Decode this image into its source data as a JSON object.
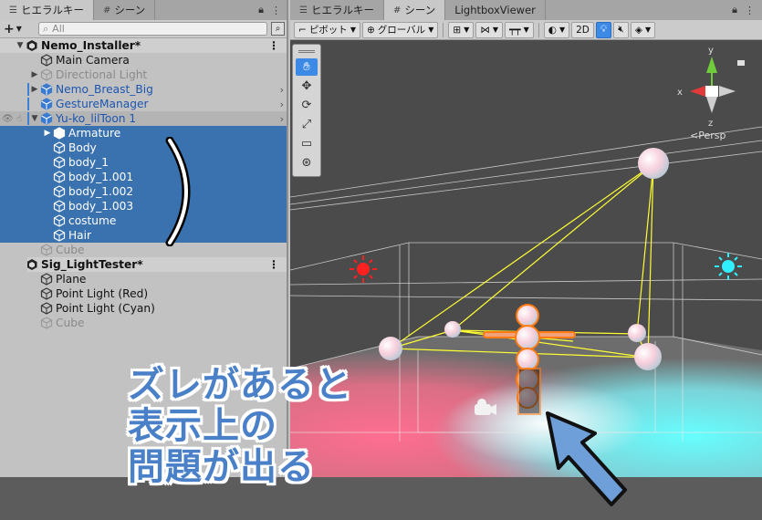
{
  "left_panel": {
    "tabs": [
      {
        "label": "ヒエラルキー",
        "icon": "list-icon",
        "active": true
      },
      {
        "label": "シーン",
        "icon": "grid-icon",
        "active": false
      }
    ],
    "search": {
      "placeholder": "All"
    },
    "tree": [
      {
        "label": "Nemo_Installer*",
        "type": "scene",
        "depth": 0,
        "expanded": true
      },
      {
        "label": "Main Camera",
        "type": "object",
        "depth": 1
      },
      {
        "label": "Directional Light",
        "type": "object",
        "depth": 1,
        "collapsed": true,
        "disabled": true
      },
      {
        "label": "Nemo_Breast_Big",
        "type": "prefab",
        "depth": 1,
        "collapsed": true
      },
      {
        "label": "GestureManager",
        "type": "prefab",
        "depth": 1
      },
      {
        "label": "Yu-ko_lilToon 1",
        "type": "prefab",
        "depth": 1,
        "expanded": true,
        "hover": true
      },
      {
        "label": "Armature",
        "type": "prefab",
        "depth": 2,
        "collapsed": true,
        "selected": true
      },
      {
        "label": "Body",
        "type": "object",
        "depth": 2,
        "selected": true
      },
      {
        "label": "body_1",
        "type": "object",
        "depth": 2,
        "selected": true
      },
      {
        "label": "body_1.001",
        "type": "object",
        "depth": 2,
        "selected": true
      },
      {
        "label": "body_1.002",
        "type": "object",
        "depth": 2,
        "selected": true
      },
      {
        "label": "body_1.003",
        "type": "object",
        "depth": 2,
        "selected": true
      },
      {
        "label": "costume",
        "type": "object",
        "depth": 2,
        "selected": true
      },
      {
        "label": "Hair",
        "type": "object",
        "depth": 2,
        "selected": true
      },
      {
        "label": "Cube",
        "type": "object",
        "depth": 1,
        "disabled": true
      },
      {
        "label": "Sig_LightTester*",
        "type": "scene",
        "depth": 0,
        "expanded": true
      },
      {
        "label": "Plane",
        "type": "object",
        "depth": 1
      },
      {
        "label": "Point Light (Red)",
        "type": "object",
        "depth": 1
      },
      {
        "label": "Point Light (Cyan)",
        "type": "object",
        "depth": 1
      },
      {
        "label": "Cube",
        "type": "object",
        "depth": 1,
        "disabled": true
      }
    ]
  },
  "right_panel": {
    "tabs": [
      {
        "label": "ヒエラルキー",
        "icon": "list-icon",
        "active": false
      },
      {
        "label": "シーン",
        "icon": "grid-icon",
        "active": true
      },
      {
        "label": "LightboxViewer",
        "icon": "",
        "active": false
      }
    ],
    "toolbar": {
      "pivot": "ピボット",
      "global": "グローバル",
      "mode_2d": "2D"
    },
    "gizmo": {
      "x": "x",
      "y": "y",
      "z": "z",
      "persp": "<Persp"
    },
    "tools": [
      "hand-tool",
      "move-tool",
      "rotate-tool",
      "scale-tool",
      "rect-tool",
      "transform-tool"
    ]
  },
  "caption": {
    "line1": "ズレがあると",
    "line2": "表示上の",
    "line3": "問題が出る"
  },
  "colors": {
    "selection": "#3a72b0",
    "prefab_text": "#1c55b0",
    "caption": "#4a80c8",
    "red_light": "#ff3030",
    "cyan_light": "#30e0ff",
    "wire": "#ffff33"
  }
}
